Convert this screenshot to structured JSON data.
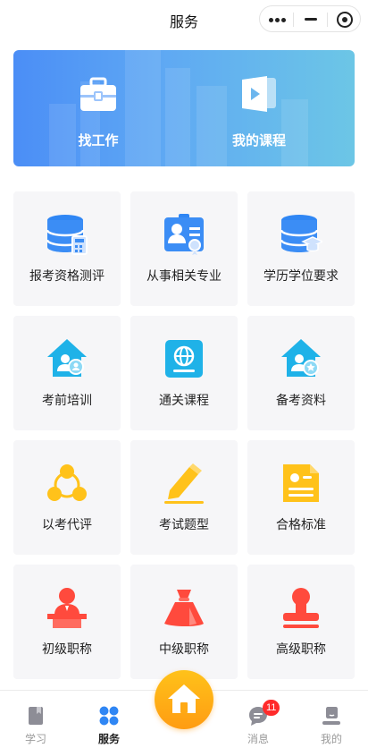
{
  "header": {
    "title": "服务"
  },
  "banner": {
    "items": [
      {
        "label": "找工作",
        "icon": "briefcase-icon"
      },
      {
        "label": "我的课程",
        "icon": "video-course-icon"
      }
    ]
  },
  "grid": {
    "items": [
      {
        "label": "报考资格测评",
        "icon": "database-calculator-icon"
      },
      {
        "label": "从事相关专业",
        "icon": "id-badge-icon"
      },
      {
        "label": "学历学位要求",
        "icon": "database-graduation-icon"
      },
      {
        "label": "考前培训",
        "icon": "home-user-icon"
      },
      {
        "label": "通关课程",
        "icon": "globe-book-icon"
      },
      {
        "label": "备考资料",
        "icon": "home-badge-icon"
      },
      {
        "label": "以考代评",
        "icon": "share-network-icon"
      },
      {
        "label": "考试题型",
        "icon": "pencil-icon"
      },
      {
        "label": "合格标准",
        "icon": "document-icon"
      },
      {
        "label": "初级职称",
        "icon": "lecturer-icon"
      },
      {
        "label": "中级职称",
        "icon": "money-bag-icon"
      },
      {
        "label": "高级职称",
        "icon": "stamp-icon"
      }
    ]
  },
  "tabbar": {
    "items": [
      {
        "label": "学习",
        "icon": "book-icon"
      },
      {
        "label": "服务",
        "icon": "grid-icon"
      },
      {
        "label": "",
        "icon": "home-icon"
      },
      {
        "label": "消息",
        "icon": "chat-icon",
        "badge": "11"
      },
      {
        "label": "我的",
        "icon": "user-icon"
      }
    ]
  },
  "colors": {
    "accent_blue": "#3b8df5",
    "accent_yellow": "#ffc21a",
    "accent_red": "#ff4a3d",
    "badge_red": "#ff2b2b"
  }
}
